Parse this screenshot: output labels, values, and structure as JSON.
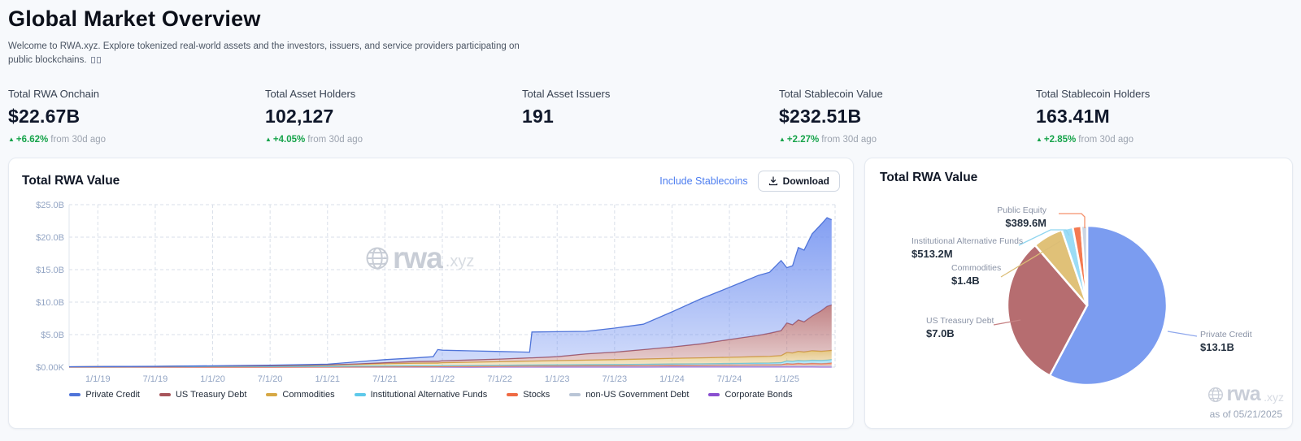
{
  "header": {
    "title": "Global Market Overview",
    "subtitle": "Welcome to RWA.xyz. Explore tokenized real-world assets and the investors, issuers, and service providers participating on public blockchains."
  },
  "stats": {
    "items": [
      {
        "label": "Total RWA Onchain",
        "value": "$22.67B",
        "delta_icon": "▲",
        "delta": "+6.62%",
        "delta_suffix": "from 30d ago"
      },
      {
        "label": "Total Asset Holders",
        "value": "102,127",
        "delta_icon": "▲",
        "delta": "+4.05%",
        "delta_suffix": "from 30d ago"
      },
      {
        "label": "Total Asset Issuers",
        "value": "191",
        "delta_icon": "",
        "delta": "",
        "delta_suffix": ""
      },
      {
        "label": "Total Stablecoin Value",
        "value": "$232.51B",
        "delta_icon": "▲",
        "delta": "+2.27%",
        "delta_suffix": "from 30d ago"
      },
      {
        "label": "Total Stablecoin Holders",
        "value": "163.41M",
        "delta_icon": "▲",
        "delta": "+2.85%",
        "delta_suffix": "from 30d ago"
      }
    ]
  },
  "area_card": {
    "title": "Total RWA Value",
    "stablecoins_link": "Include Stablecoins",
    "download_label": "Download",
    "watermark_brand": "rwa",
    "watermark_tld": ".xyz"
  },
  "pie_card": {
    "title": "Total RWA Value",
    "as_of": "as of 05/21/2025",
    "watermark_brand": "rwa",
    "watermark_tld": ".xyz"
  },
  "chart_data": [
    {
      "type": "area",
      "title": "Total RWA Value",
      "stacked": true,
      "unit": "$B",
      "ylim": [
        0,
        25
      ],
      "x_range": [
        2018.75,
        2025.42
      ],
      "grid": true,
      "legend_position": "bottom",
      "y_ticks": [
        {
          "label": "$0.00K",
          "value": 0
        },
        {
          "label": "$5.0B",
          "value": 5
        },
        {
          "label": "$10.0B",
          "value": 10
        },
        {
          "label": "$15.0B",
          "value": 15
        },
        {
          "label": "$20.0B",
          "value": 20
        },
        {
          "label": "$25.0B",
          "value": 25
        }
      ],
      "x_tick_labels": [
        "1/1/19",
        "7/1/19",
        "1/1/20",
        "7/1/20",
        "1/1/21",
        "7/1/21",
        "1/1/22",
        "7/1/22",
        "1/1/23",
        "7/1/23",
        "1/1/24",
        "7/1/24",
        "1/1/25"
      ],
      "x_tick_years": [
        2019.0,
        2019.5,
        2020.0,
        2020.5,
        2021.0,
        2021.5,
        2022.0,
        2022.5,
        2023.0,
        2023.5,
        2024.0,
        2024.5,
        2025.0
      ],
      "x_years": [
        2018.75,
        2019.0,
        2019.5,
        2020.0,
        2020.5,
        2021.0,
        2021.25,
        2021.5,
        2021.75,
        2021.92,
        2021.96,
        2022.0,
        2022.25,
        2022.5,
        2022.76,
        2022.78,
        2023.0,
        2023.25,
        2023.5,
        2023.75,
        2024.0,
        2024.25,
        2024.42,
        2024.6,
        2024.75,
        2024.85,
        2024.95,
        2025.0,
        2025.05,
        2025.1,
        2025.15,
        2025.22,
        2025.3,
        2025.35,
        2025.39
      ],
      "stack_order_bottom_to_top": [
        "Corporate Bonds",
        "non-US Government Debt",
        "Stocks",
        "Institutional Alternative Funds",
        "Commodities",
        "US Treasury Debt",
        "Private Credit"
      ],
      "series": [
        {
          "name": "Private Credit",
          "color": "#6d8ef0",
          "stroke": "#4f74d9",
          "values": [
            0.01,
            0.01,
            0.02,
            0.04,
            0.09,
            0.11,
            0.32,
            0.48,
            0.55,
            0.7,
            1.8,
            1.63,
            1.4,
            1.17,
            0.88,
            3.98,
            3.85,
            3.47,
            3.7,
            3.91,
            5.41,
            6.93,
            7.67,
            8.5,
            9.23,
            9.39,
            10.79,
            8.5,
            9.08,
            11.13,
            11.03,
            12.64,
            13.32,
            13.65,
            13.1
          ]
        },
        {
          "name": "US Treasury Debt",
          "color": "#b66d70",
          "stroke": "#a8555b",
          "values": [
            0,
            0,
            0,
            0,
            0,
            0.02,
            0.05,
            0.15,
            0.25,
            0.28,
            0.28,
            0.3,
            0.35,
            0.4,
            0.5,
            0.5,
            0.6,
            0.95,
            1.15,
            1.45,
            1.75,
            2.15,
            2.55,
            2.95,
            3.25,
            3.55,
            3.85,
            4.55,
            4.35,
            4.85,
            4.65,
            5.35,
            6.25,
            6.85,
            7.0
          ]
        },
        {
          "name": "Commodities",
          "color": "#e0bd71",
          "stroke": "#d6a844",
          "values": [
            0.01,
            0.02,
            0.04,
            0.08,
            0.12,
            0.2,
            0.28,
            0.35,
            0.4,
            0.42,
            0.42,
            0.45,
            0.5,
            0.55,
            0.6,
            0.6,
            0.65,
            0.7,
            0.75,
            0.8,
            0.85,
            0.9,
            0.93,
            0.97,
            1.0,
            1.03,
            1.08,
            1.3,
            1.28,
            1.4,
            1.35,
            1.45,
            1.4,
            1.42,
            1.4
          ]
        },
        {
          "name": "Institutional Alternative Funds",
          "color": "#8ed7f2",
          "stroke": "#5ec9ea",
          "values": [
            0.04,
            0.05,
            0.06,
            0.08,
            0.09,
            0.1,
            0.11,
            0.12,
            0.13,
            0.13,
            0.13,
            0.13,
            0.14,
            0.15,
            0.15,
            0.15,
            0.16,
            0.17,
            0.18,
            0.19,
            0.2,
            0.22,
            0.23,
            0.25,
            0.27,
            0.28,
            0.3,
            0.4,
            0.4,
            0.44,
            0.45,
            0.48,
            0.5,
            0.51,
            0.51
          ]
        },
        {
          "name": "Stocks",
          "color": "#f48a66",
          "stroke": "#ef6a43",
          "values": [
            0,
            0,
            0,
            0,
            0,
            0,
            0.01,
            0.01,
            0.02,
            0.02,
            0.02,
            0.02,
            0.03,
            0.03,
            0.05,
            0.05,
            0.05,
            0.06,
            0.06,
            0.07,
            0.08,
            0.08,
            0.09,
            0.09,
            0.1,
            0.1,
            0.12,
            0.28,
            0.22,
            0.3,
            0.24,
            0.3,
            0.26,
            0.3,
            0.39
          ]
        },
        {
          "name": "non-US Government Debt",
          "color": "#ccd5e2",
          "stroke": "#b9c5d6",
          "values": [
            0,
            0,
            0,
            0,
            0,
            0.02,
            0.03,
            0.04,
            0.05,
            0.05,
            0.05,
            0.06,
            0.07,
            0.08,
            0.1,
            0.1,
            0.12,
            0.13,
            0.14,
            0.16,
            0.18,
            0.19,
            0.2,
            0.21,
            0.22,
            0.22,
            0.23,
            0.24,
            0.24,
            0.25,
            0.25,
            0.25,
            0.25,
            0.25,
            0.25
          ]
        },
        {
          "name": "Corporate Bonds",
          "color": "#a375dc",
          "stroke": "#8a4fd0",
          "values": [
            0,
            0,
            0,
            0,
            0,
            0,
            0,
            0,
            0,
            0,
            0,
            0.01,
            0.01,
            0.02,
            0.02,
            0.02,
            0.02,
            0.02,
            0.02,
            0.02,
            0.03,
            0.03,
            0.03,
            0.03,
            0.03,
            0.03,
            0.03,
            0.03,
            0.03,
            0.03,
            0.03,
            0.03,
            0.02,
            0.02,
            0.02
          ]
        }
      ]
    },
    {
      "type": "pie",
      "title": "Total RWA Value",
      "as_of": "05/21/2025",
      "slices": [
        {
          "label": "Private Credit",
          "value": 13.1,
          "display": "$13.1B",
          "color": "#7b9cf0"
        },
        {
          "label": "US Treasury Debt",
          "value": 7.0,
          "display": "$7.0B",
          "color": "#b66d70"
        },
        {
          "label": "Commodities",
          "value": 1.4,
          "display": "$1.4B",
          "color": "#e0c178"
        },
        {
          "label": "Institutional Alternative Funds",
          "value": 0.5132,
          "display": "$513.2M",
          "color": "#9bdcf5"
        },
        {
          "label": "Public Equity",
          "value": 0.3896,
          "display": "$389.6M",
          "color": "#f47a51"
        },
        {
          "label": "",
          "value": 0.27,
          "display": "",
          "color": "#ccd5e2"
        }
      ]
    }
  ],
  "colors": {
    "accent_blue": "#4c7df0",
    "delta_green": "#16a34a",
    "axis_label": "#93a5c4",
    "grid": "#d9dfe9"
  }
}
